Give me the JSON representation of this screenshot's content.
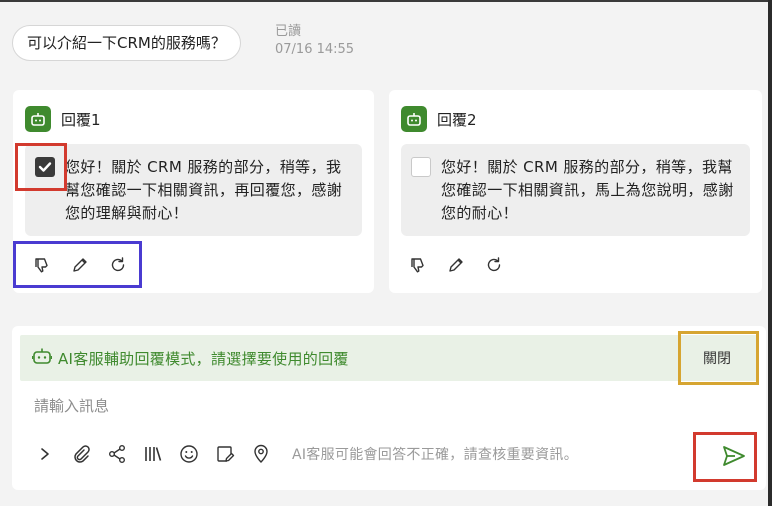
{
  "conversation": {
    "user_message": "可以介紹一下CRM的服務嗎？",
    "read_status": "已讀",
    "timestamp": "07/16 14:55"
  },
  "replies": [
    {
      "title": "回覆1",
      "text": "您好！關於 CRM 服務的部分，稍等，我幫您確認一下相關資訊，再回覆您，感謝您的理解與耐心！",
      "selected": true
    },
    {
      "title": "回覆2",
      "text": "您好！關於 CRM 服務的部分，稍等，我幫您確認一下相關資訊，馬上為您說明，感謝您的耐心！",
      "selected": false
    }
  ],
  "reply_actions": [
    "thumbs-down-icon",
    "pencil-icon",
    "refresh-icon"
  ],
  "composer": {
    "ai_mode_text": "AI客服輔助回覆模式，請選擇要使用的回覆",
    "close_label": "關閉",
    "input_placeholder": "請輸入訊息",
    "disclaimer": "AI客服可能會回答不正確，請查核重要資訊。",
    "tools": [
      "chevron-right-icon",
      "paperclip-icon",
      "share-icon",
      "library-icon",
      "emoji-icon",
      "note-edit-icon",
      "location-pin-icon"
    ]
  },
  "colors": {
    "brand_green": "#3f8a2e",
    "banner_bg": "#e9f1e6",
    "highlight_red": "#d23a2e",
    "highlight_blue": "#4a3bd1",
    "highlight_gold": "#d6a531"
  }
}
